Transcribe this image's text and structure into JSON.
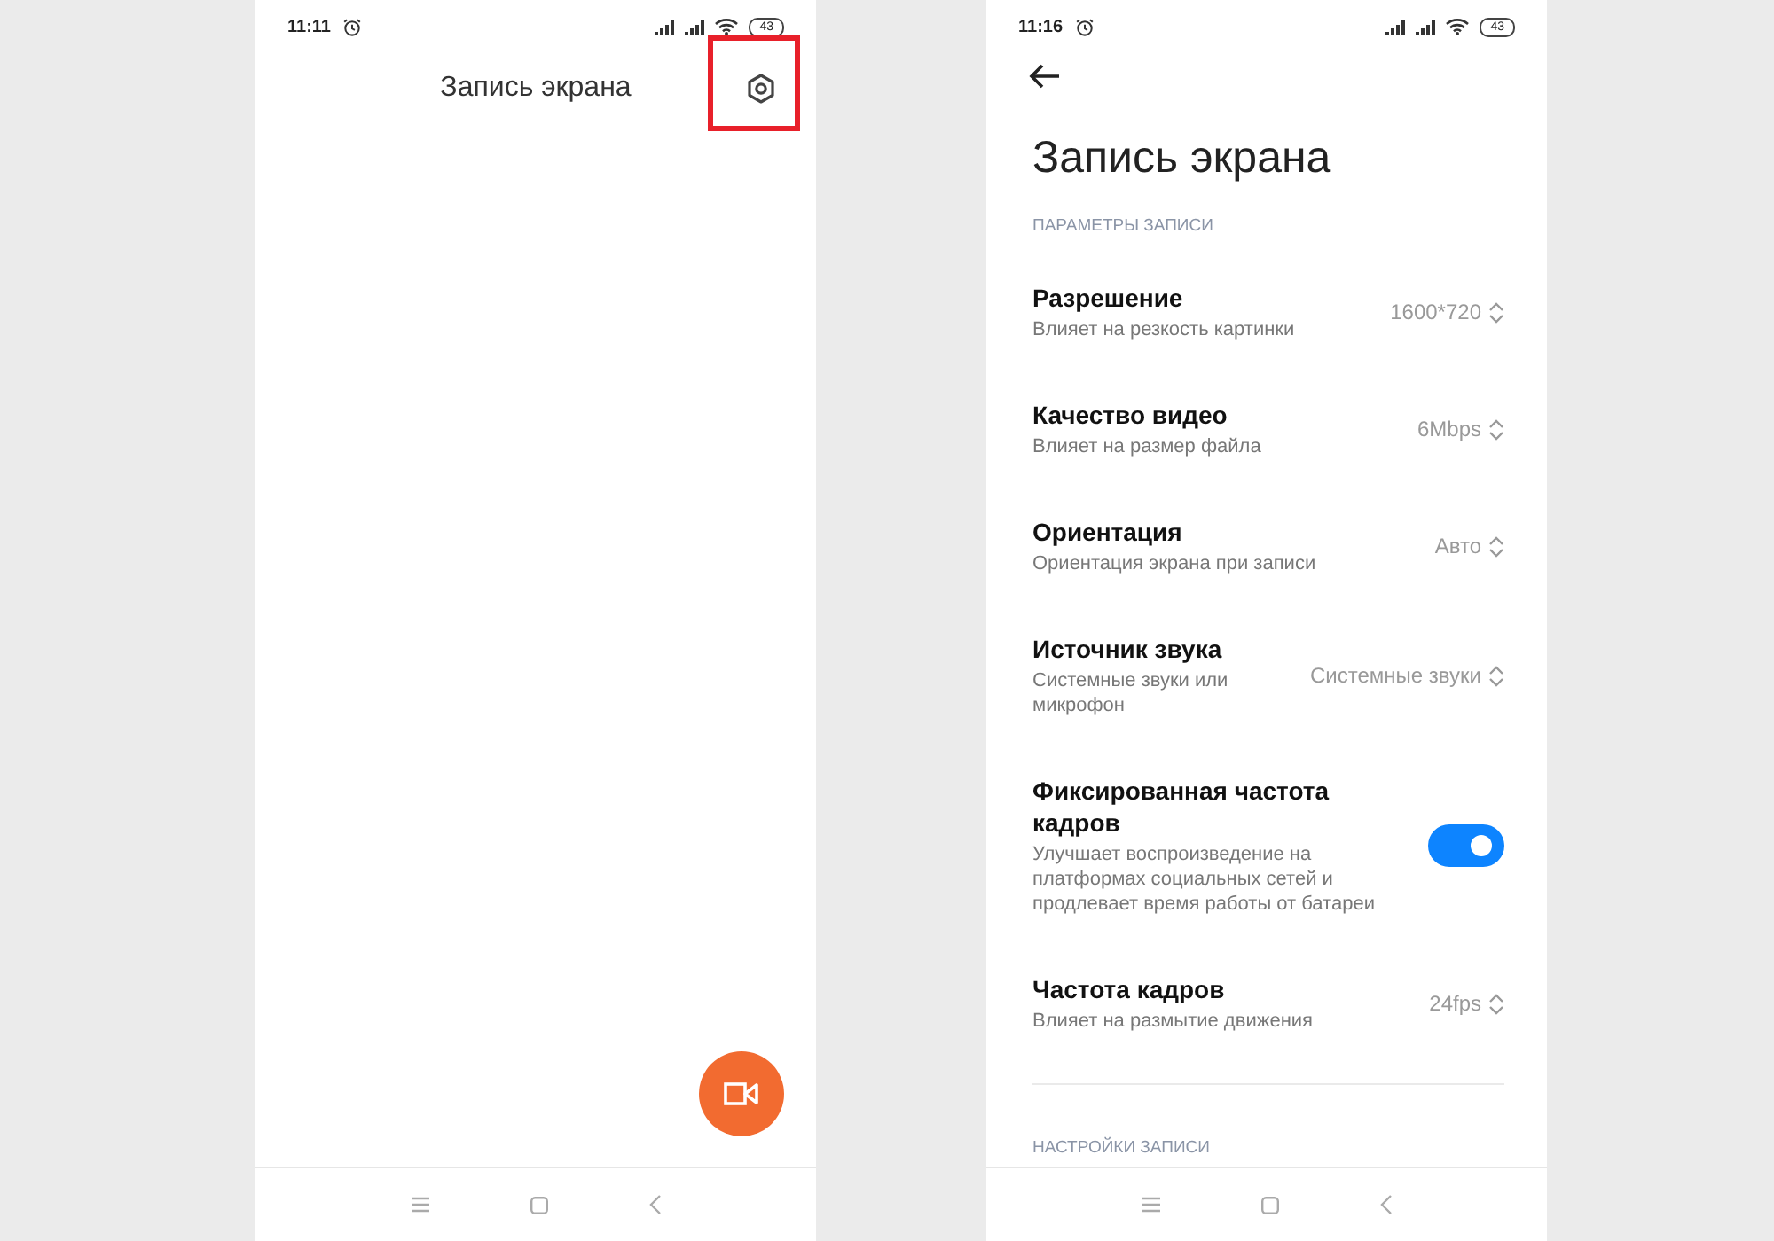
{
  "left_screen": {
    "status_bar": {
      "time": "11:11",
      "battery": "43"
    },
    "title": "Запись экрана",
    "highlight": true
  },
  "right_screen": {
    "status_bar": {
      "time": "11:16",
      "battery": "43"
    },
    "title": "Запись экрана",
    "section": "ПАРАМЕТРЫ ЗАПИСИ",
    "settings": [
      {
        "kind": "select",
        "title": "Разрешение",
        "subtitle": "Влияет на резкость картинки",
        "value": "1600*720"
      },
      {
        "kind": "select",
        "title": "Качество видео",
        "subtitle": "Влияет на размер файла",
        "value": "6Mbps"
      },
      {
        "kind": "select",
        "title": "Ориентация",
        "subtitle": "Ориентация экрана при записи",
        "value": "Авто"
      },
      {
        "kind": "select",
        "title": "Источник звука",
        "subtitle": "Системные звуки или микрофон",
        "value": "Системные звуки"
      },
      {
        "kind": "toggle",
        "title": "Фиксированная частота кадров",
        "subtitle": "Улучшает воспроизведение на платформах социальных сетей и продлевает время работы от батареи",
        "on": true
      },
      {
        "kind": "select",
        "title": "Частота кадров",
        "subtitle": "Влияет на размытие движения",
        "value": "24fps"
      }
    ],
    "next_section": "НАСТРОЙКИ ЗАПИСИ"
  }
}
